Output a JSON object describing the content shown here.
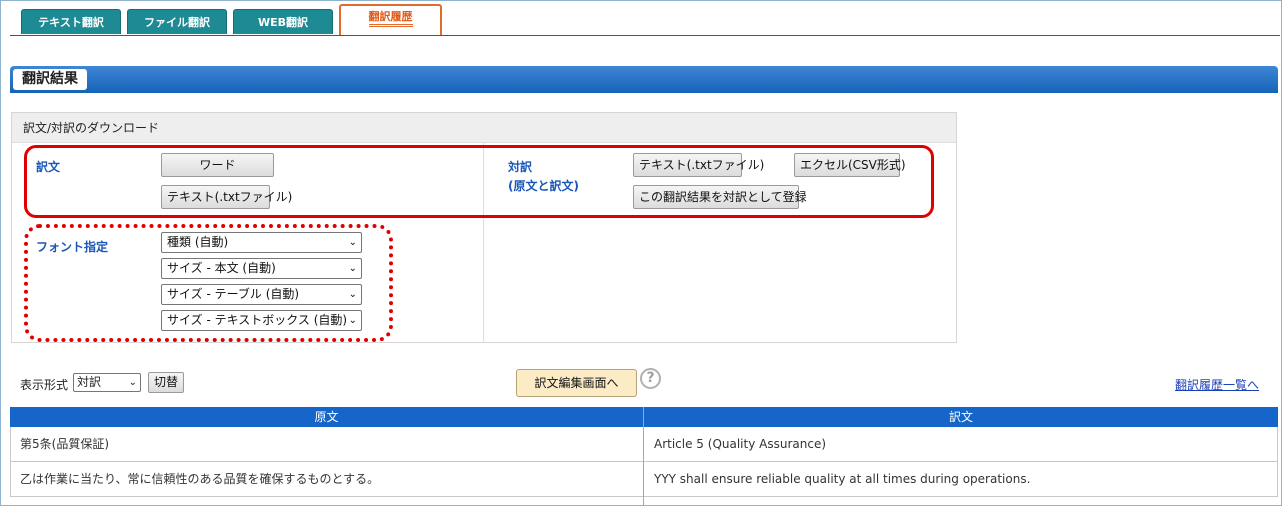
{
  "tabs": [
    {
      "label": "テキスト翻訳",
      "active": false
    },
    {
      "label": "ファイル翻訳",
      "active": false
    },
    {
      "label": "WEB翻訳",
      "active": false
    },
    {
      "label": "翻訳履歴",
      "active": true
    }
  ],
  "result_title": "翻訳結果",
  "download": {
    "header": "訳文/対訳のダウンロード",
    "translation_label": "訳文",
    "word_button": "ワード",
    "text_button": "テキスト(.txtファイル)",
    "parallel_label_1": "対訳",
    "parallel_label_2": "(原文と訳文)",
    "parallel_text_button": "テキスト(.txtファイル)",
    "excel_button": "エクセル(CSV形式)",
    "register_button": "この翻訳結果を対訳として登録",
    "font_label": "フォント指定",
    "font_selects": [
      "種類 (自動)",
      "サイズ - 本文 (自動)",
      "サイズ - テーブル (自動)",
      "サイズ - テキストボックス (自動)"
    ]
  },
  "display": {
    "label": "表示形式",
    "mode_value": "対訳",
    "switch_button": "切替",
    "edit_button": "訳文編集画面へ",
    "help_symbol": "?",
    "history_link": "翻訳履歴一覧へ"
  },
  "table": {
    "headers": [
      "原文",
      "訳文"
    ],
    "rows": [
      [
        "第5条(品質保証)",
        "Article 5 (Quality Assurance)"
      ],
      [
        "乙は作業に当たり、常に信頼性のある品質を確保するものとする。",
        "YYY shall ensure reliable quality at all times during operations."
      ]
    ]
  },
  "colors": {
    "tab_bg": "#1e8a93",
    "active_tab_accent": "#e26c2d",
    "header_bar": "#1563b8",
    "label_blue": "#1a57b8",
    "highlight_red": "#e00000",
    "table_header": "#1566c8"
  }
}
